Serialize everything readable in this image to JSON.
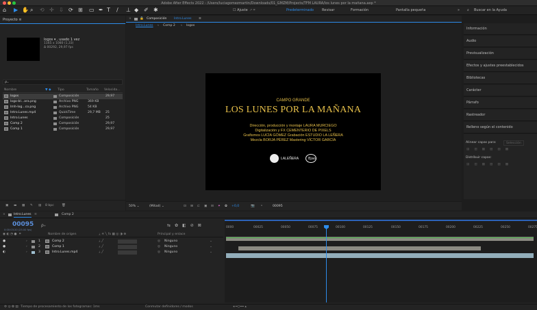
{
  "window": {
    "title": "Adobe After Effects 2022 - /Users/luciagomezmartin/Downloads/01_GMZM/Projects/TFM LAURA/los lunes por la mañana.aep *"
  },
  "toolbar": {
    "ajuste": "Ajuste",
    "workspaces": [
      "Predeterminado",
      "Revisar",
      "Formación",
      "Pantalla pequeña"
    ],
    "active_workspace": "Predeterminado",
    "search_placeholder": "Buscar en la Ayuda"
  },
  "project": {
    "title": "Proyecto",
    "menu": "≡",
    "selected": {
      "name": "logos ▾ , usado 1 vez",
      "res": "1165 x 1080 (1,33)",
      "dur": "Δ 00292, 29,97 fps"
    },
    "search_icon": "ρ₊",
    "columns": [
      "Nombre",
      "Tipo",
      "Tamaño",
      "Velocida..."
    ],
    "items": [
      {
        "name": "logos",
        "type": "Composición",
        "size": "",
        "fps": "29,97",
        "color": "#8f8f8f",
        "kind": "comp",
        "selected": true
      },
      {
        "name": "logo-bl...ara.png",
        "type": "Archivo PNG",
        "size": "369 KB",
        "fps": "",
        "color": "#8f8f8f",
        "kind": "file"
      },
      {
        "name": "lmh-log...co.png",
        "type": "Archivo PNG",
        "size": "54 KB",
        "fps": "",
        "color": "#8f8f8f",
        "kind": "file"
      },
      {
        "name": "Intro.Lunes.mp4",
        "type": "QuickTime",
        "size": "29,7 MB",
        "fps": "25",
        "color": "#8f8f8f",
        "kind": "file"
      },
      {
        "name": "Intro.Lunes",
        "type": "Composición",
        "size": "",
        "fps": "25",
        "color": "#8f8f8f",
        "kind": "comp"
      },
      {
        "name": "Comp 2",
        "type": "Composición",
        "size": "",
        "fps": "29,97",
        "color": "#8f8f8f",
        "kind": "comp"
      },
      {
        "name": "Comp 1",
        "type": "Composición",
        "size": "",
        "fps": "29,97",
        "color": "#8f8f8f",
        "kind": "comp"
      }
    ],
    "bpc": "8 bpc"
  },
  "composition": {
    "title": "Composición",
    "name": "Intro.Lunes",
    "breadcrumbs": [
      "Intro.Lunes",
      "Comp 2",
      "logos"
    ],
    "frame": {
      "line1": "CAMPO GRANDE",
      "title": "LOS LUNES POR LA MAÑANA",
      "credits": [
        "Dirección, producción y montaje LAURA MURCIEGO",
        "Digitalización y FX CEMENTERIO DE PIXELS",
        "Grafismos LUCÍA GÓMEZ Grabación ESTUDIO LA LEÑERA",
        "Mezcla BORJA PÉREZ Mastering VÍCTOR GARCÍA"
      ],
      "logo1": "LALEÑERA",
      "logo2": "Bjao"
    },
    "footer": {
      "zoom": "50%",
      "quality": "(Mitad)",
      "exposure": "+0,0",
      "timecode": "00095"
    }
  },
  "right_panel": {
    "items": [
      "Información",
      "Audio",
      "Previsualización",
      "Efectos y ajustes preestablecidos",
      "Bibliotecas",
      "Carácter",
      "Párrafo",
      "Rastreador",
      "Relleno según el contenido",
      "Alinear"
    ],
    "align": {
      "align_to_label": "Alinear capas para:",
      "align_to_value": "Selección",
      "distribute_label": "Distribuir capas:"
    }
  },
  "timeline": {
    "tabs": [
      {
        "name": "Intro.Lunes",
        "active": true
      },
      {
        "name": "Comp 2",
        "active": false
      }
    ],
    "timecode": "00095",
    "timecode_sub": "0:00:03:20 (25.00 fps)",
    "col_source": "Nombre de origen",
    "col_parent": "Principal y enlace",
    "layers": [
      {
        "num": "1",
        "name": "Comp 2",
        "parent": "Ninguno",
        "color": "#8f8f8f",
        "kind": "comp"
      },
      {
        "num": "2",
        "name": "Comp 1",
        "parent": "Ninguno",
        "color": "#8f8f8f",
        "kind": "comp"
      },
      {
        "num": "3",
        "name": "Intro.Lunes.mp4",
        "parent": "Ninguno",
        "color": "#9fbfd0",
        "kind": "file"
      }
    ],
    "ruler": [
      "0000",
      "00025",
      "00050",
      "00075",
      "00100",
      "00125",
      "00150",
      "00175",
      "00200",
      "00225",
      "00250",
      "00275"
    ],
    "playhead": "00095",
    "footer": {
      "render_time": "Tiempo de procesamiento de los fotogramas: 1ms",
      "switches": "Conmutar definidores / modos"
    }
  }
}
